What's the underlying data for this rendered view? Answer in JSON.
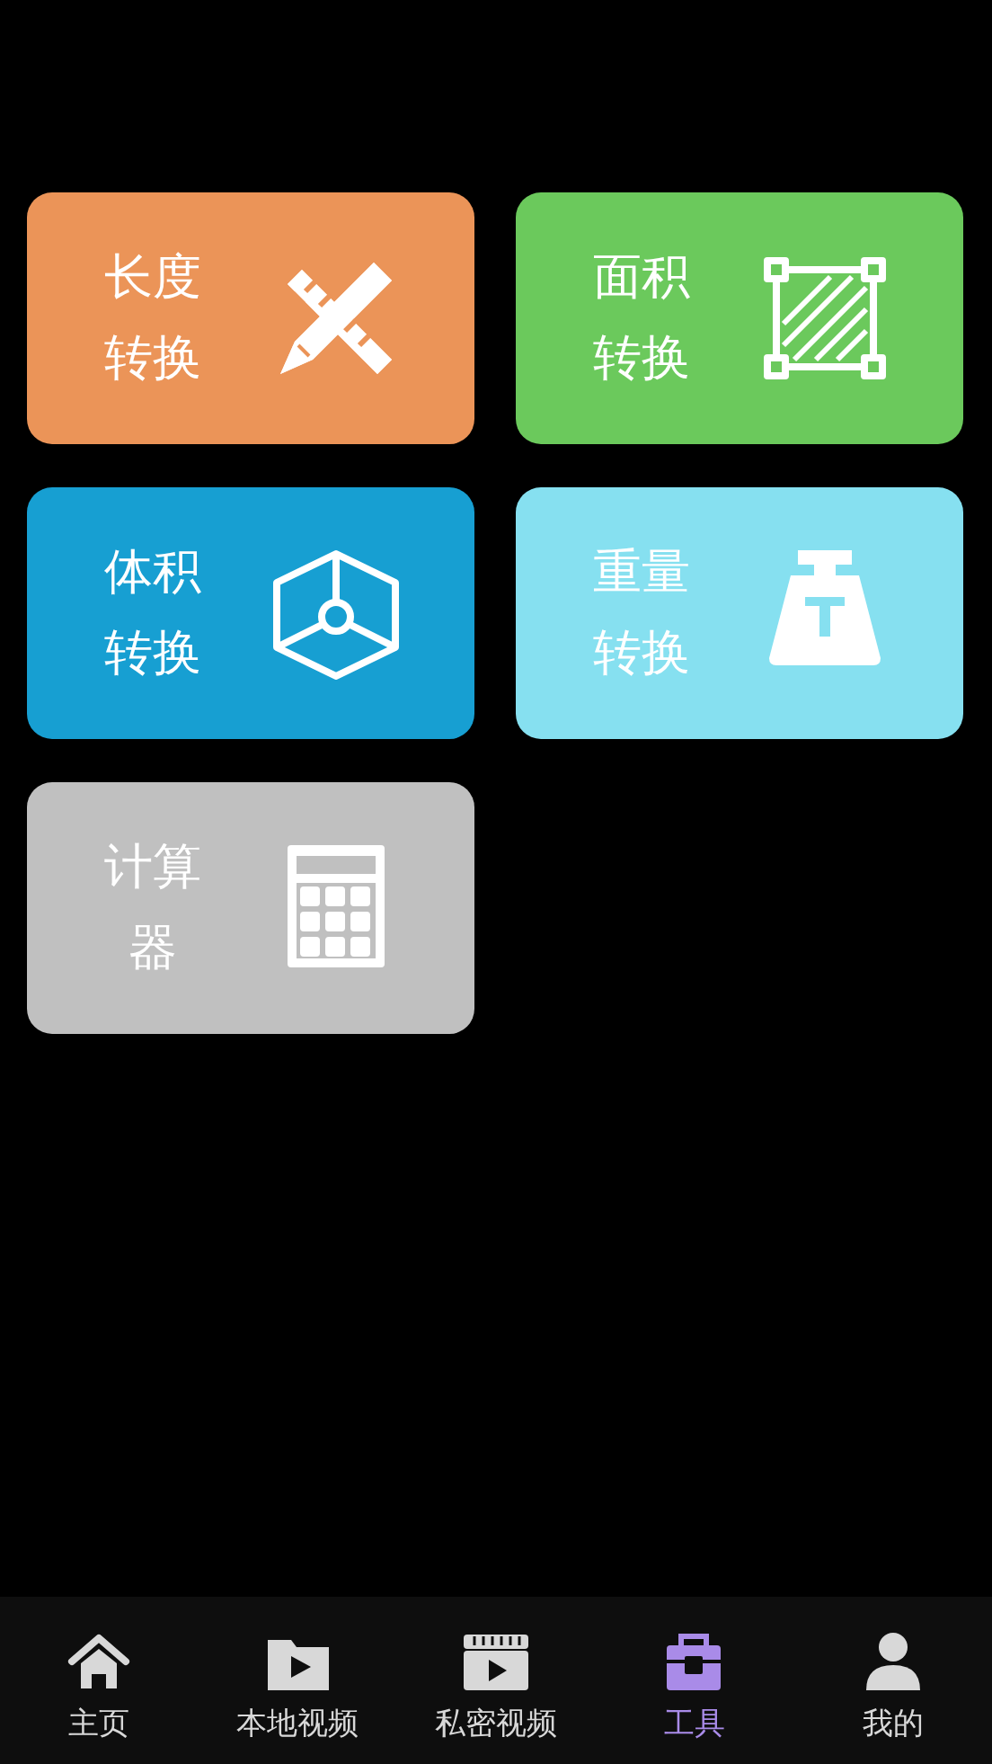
{
  "tiles": [
    {
      "title": "长度转换",
      "kind": "ruler",
      "color": "#eb9458"
    },
    {
      "title": "面积转换",
      "kind": "area",
      "color": "#6bc95c"
    },
    {
      "title": "体积转换",
      "kind": "volume",
      "color": "#179fd2"
    },
    {
      "title": "重量转换",
      "kind": "weight",
      "color": "#86e0f0"
    },
    {
      "title": "计算器",
      "kind": "calculator",
      "color": "#c0c0c0"
    }
  ],
  "nav": [
    {
      "label": "主页",
      "kind": "home",
      "selected": false
    },
    {
      "label": "本地视频",
      "kind": "local",
      "selected": false
    },
    {
      "label": "私密视频",
      "kind": "private",
      "selected": false
    },
    {
      "label": "工具",
      "kind": "tools",
      "selected": true
    },
    {
      "label": "我的",
      "kind": "me",
      "selected": false
    }
  ]
}
